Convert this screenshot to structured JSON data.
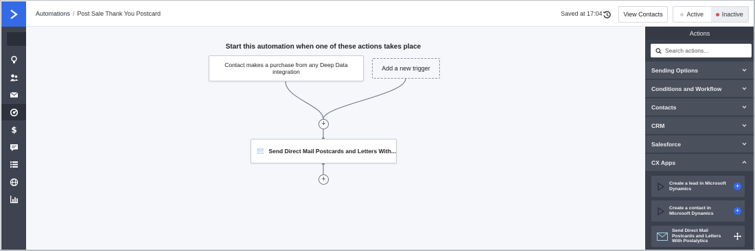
{
  "breadcrumb": {
    "root": "Automations",
    "separator": "/",
    "current": "Post Sale Thank You Postcard"
  },
  "header": {
    "saved_text": "Saved at 17:04",
    "view_contacts_label": "View Contacts",
    "status_toggle": {
      "active_label": "Active",
      "inactive_label": "Inactive",
      "selected": "Inactive"
    }
  },
  "left_nav": {
    "icons": [
      "search-icon",
      "lightbulb-icon",
      "contacts-icon",
      "email-icon",
      "automations-icon",
      "deals-icon",
      "conversations-icon",
      "lists-icon",
      "site-icon",
      "reports-icon"
    ],
    "active": "automations-icon"
  },
  "canvas": {
    "heading": "Start this automation when one of these actions takes place",
    "trigger_label": "Contact makes a purchase from any Deep Data integration",
    "add_trigger_label": "Add a new trigger",
    "action_label": "Send Direct Mail Postcards and Letters With..."
  },
  "panel": {
    "title": "Actions",
    "search_placeholder": "Search actions...",
    "categories": [
      {
        "label": "Sending Options",
        "expanded": false
      },
      {
        "label": "Conditions and Workflow",
        "expanded": false
      },
      {
        "label": "Contacts",
        "expanded": false
      },
      {
        "label": "CRM",
        "expanded": false
      },
      {
        "label": "Salesforce",
        "expanded": false
      },
      {
        "label": "CX Apps",
        "expanded": true
      }
    ],
    "cx_apps_items": [
      {
        "label": "Create a lead in Microsoft Dynamics",
        "icon": "dynamics-icon",
        "action": "add"
      },
      {
        "label": "Create a contact in Microsoft Dynamics",
        "icon": "dynamics-icon",
        "action": "add"
      },
      {
        "label": "Send Direct Mail Postcards and Letters With Postalytics",
        "icon": "mail-envelope-icon",
        "action": "move"
      }
    ]
  },
  "colors": {
    "brand_blue": "#356ae6",
    "nav_bg": "#3d4350",
    "panel_bg": "#3a404c",
    "canvas_bg": "#f6f7fa",
    "inactive_dot": "#e5484d",
    "active_dot": "#cfd3d9"
  }
}
